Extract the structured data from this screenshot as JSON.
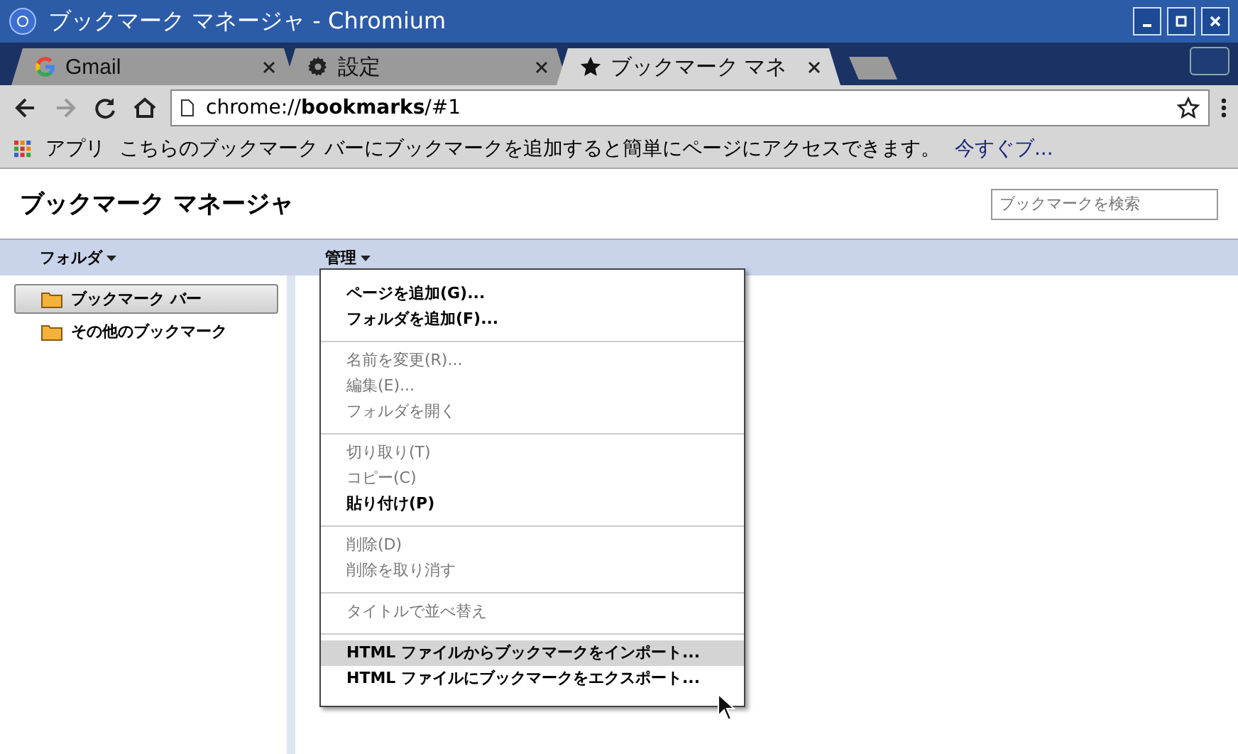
{
  "window": {
    "title": "ブックマーク マネージャ - Chromium"
  },
  "tabs": [
    {
      "label": "Gmail",
      "kind": "google",
      "selected": false
    },
    {
      "label": "設定",
      "kind": "gear",
      "selected": false
    },
    {
      "label": "ブックマーク マネ",
      "kind": "star",
      "selected": true
    }
  ],
  "address_bar": {
    "prefix": "chrome://",
    "host": "bookmarks",
    "suffix": "/#1"
  },
  "bookmarks_bar": {
    "apps": "アプリ",
    "message": "こちらのブックマーク バーにブックマークを追加すると簡単にページにアクセスできます。",
    "link": "今すぐブ..."
  },
  "page": {
    "title": "ブックマーク マネージャ",
    "search": {
      "placeholder": "ブックマークを検索"
    }
  },
  "toolbar": {
    "folders_menu": "フォルダ",
    "organize_menu": "管理"
  },
  "folders": [
    {
      "label": "ブックマーク バー",
      "selected": true
    },
    {
      "label": "その他のブックマーク",
      "selected": false
    }
  ],
  "menu": {
    "groups": [
      {
        "items": [
          {
            "label": "ページを追加(G)...",
            "disabled": false,
            "selected": false
          },
          {
            "label": "フォルダを追加(F)...",
            "disabled": false,
            "selected": false
          }
        ]
      },
      {
        "items": [
          {
            "label": "名前を変更(R)...",
            "disabled": true,
            "selected": false
          },
          {
            "label": "編集(E)...",
            "disabled": true,
            "selected": false
          },
          {
            "label": "フォルダを開く",
            "disabled": true,
            "selected": false
          }
        ]
      },
      {
        "items": [
          {
            "label": "切り取り(T)",
            "disabled": true,
            "selected": false
          },
          {
            "label": "コピー(C)",
            "disabled": true,
            "selected": false
          },
          {
            "label": "貼り付け(P)",
            "disabled": false,
            "selected": false
          }
        ]
      },
      {
        "items": [
          {
            "label": "削除(D)",
            "disabled": true,
            "selected": false
          },
          {
            "label": "削除を取り消す",
            "disabled": true,
            "selected": false
          }
        ]
      },
      {
        "items": [
          {
            "label": "タイトルで並べ替え",
            "disabled": true,
            "selected": false
          }
        ]
      },
      {
        "items": [
          {
            "label": "HTML ファイルからブックマークをインポート...",
            "disabled": false,
            "selected": true
          },
          {
            "label": "HTML ファイルにブックマークをエクスポート...",
            "disabled": false,
            "selected": false
          }
        ]
      }
    ]
  }
}
